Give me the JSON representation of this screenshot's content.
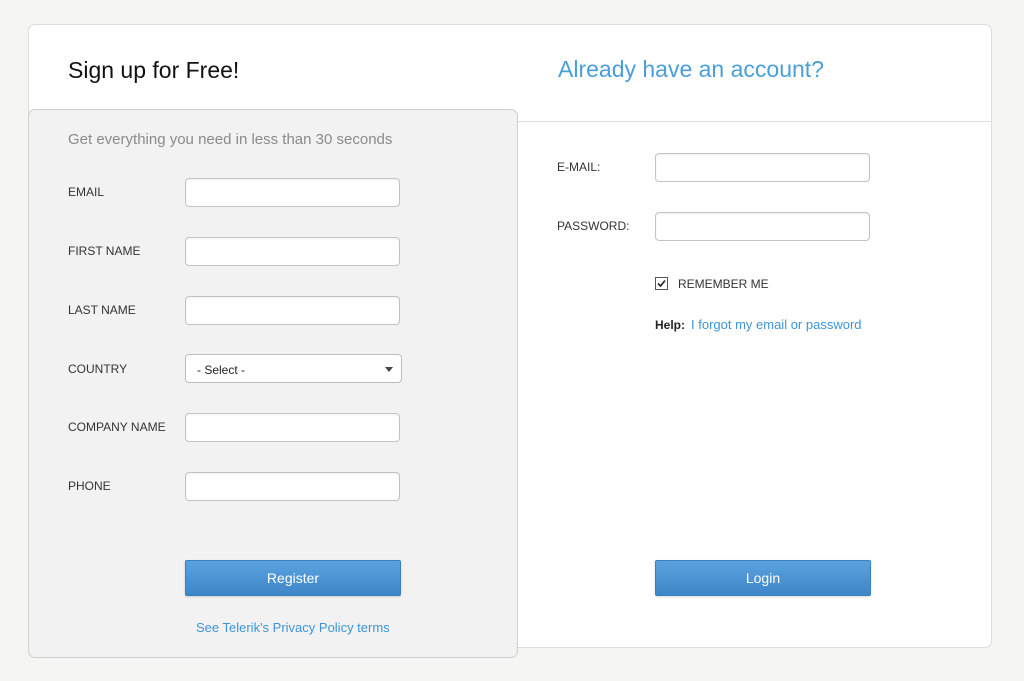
{
  "signup": {
    "title": "Sign up for Free!",
    "subtitle": "Get everything you need in less than 30 seconds",
    "fields": {
      "email_label": "EMAIL",
      "first_name_label": "FIRST NAME",
      "last_name_label": "LAST NAME",
      "country_label": "COUNTRY",
      "country_selected": "- Select -",
      "company_label": "COMPANY NAME",
      "phone_label": "PHONE"
    },
    "register_label": "Register",
    "privacy_link": "See Telerik's Privacy Policy terms"
  },
  "login": {
    "title": "Already have an account?",
    "email_label": "E-MAIL:",
    "password_label": "PASSWORD:",
    "remember_label": "REMEMBER ME",
    "remember_checked": true,
    "help_label": "Help:",
    "forgot_link": "I forgot my email or password",
    "login_label": "Login"
  },
  "colors": {
    "accent": "#4a9fd9",
    "button": "#4a90d0",
    "panel": "#f2f2f2"
  }
}
